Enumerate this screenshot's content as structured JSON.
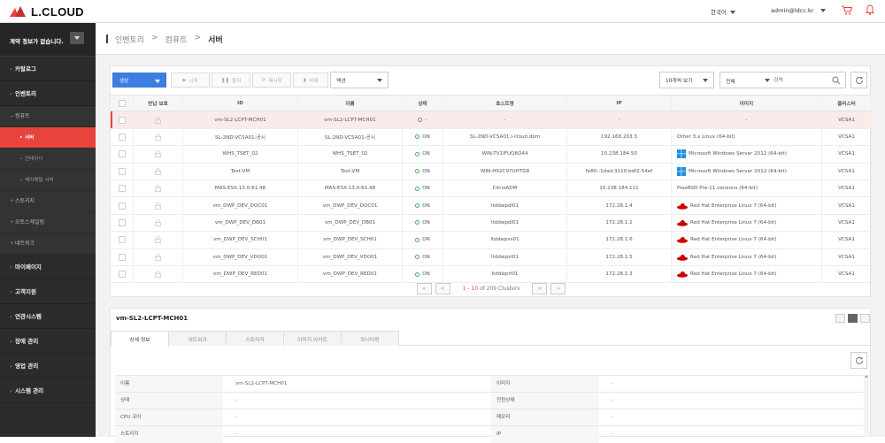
{
  "brand": {
    "name": "L.CLOUD",
    "colors": {
      "accent": "#e8433d",
      "primary": "#3d7ee0",
      "sidebar": "#2b2b2b"
    }
  },
  "topbar": {
    "language": "한국어",
    "user": "admin@ldcc.kr",
    "cart_icon": "cart-icon",
    "bell_icon": "bell-icon"
  },
  "sidebar": {
    "contract": "계약 정보가 없습니다.",
    "items": [
      {
        "label": "카탈로그",
        "level": 1
      },
      {
        "label": "인벤토리",
        "level": 1
      },
      {
        "label": "컴퓨트",
        "level": 2
      },
      {
        "label": "서버",
        "level": 3,
        "active": true
      },
      {
        "label": "컨테이너",
        "level": 3
      },
      {
        "label": "베어메탈 서버",
        "level": 3
      },
      {
        "label": "스토리지",
        "level": 2
      },
      {
        "label": "오토스케일링",
        "level": 2
      },
      {
        "label": "네트워크",
        "level": 2
      },
      {
        "label": "마이페이지",
        "level": 1
      },
      {
        "label": "고객지원",
        "level": 1
      },
      {
        "label": "연관시스템",
        "level": 1
      },
      {
        "label": "장애 관리",
        "level": 1
      },
      {
        "label": "영업 관리",
        "level": 1
      },
      {
        "label": "시스템 관리",
        "level": 1
      }
    ]
  },
  "breadcrumb": {
    "items": [
      "인벤토리",
      ">",
      "컴퓨트",
      ">",
      "서버"
    ]
  },
  "toolbar": {
    "create": "생성",
    "start": "시작",
    "stop": "중지",
    "restart": "재시작",
    "delete": "삭제",
    "action": "액션",
    "page_size": "10개씩 보기",
    "filter": "전체",
    "search_placeholder": "검색"
  },
  "table": {
    "headers": [
      "",
      "반납 보호",
      "ID",
      "이름",
      "상태",
      "호스트명",
      "IP",
      "이미지",
      "클러스터"
    ],
    "rows": [
      {
        "id": "vm-SL2-LCPT-MCH01",
        "name": "vm-SL2-LCPT-MCH01",
        "status": "-",
        "status_on": false,
        "host": "-",
        "ip": "-",
        "image": "-",
        "os": "none",
        "cluster": "VCSA1",
        "selected": true
      },
      {
        "id": "SL-2ND-VCSA01-공시",
        "name": "SL-2ND-VCSA01-공시",
        "status": "ON",
        "status_on": true,
        "host": "SL-2ND-VCSA01.l-cloud.dom",
        "ip": "192.168.203.3",
        "image": "Other 3.x Linux (64-bit)",
        "os": "none",
        "cluster": "VCSA1"
      },
      {
        "id": "WHS_TSET_02",
        "name": "WHS_TSET_02",
        "status": "ON",
        "status_on": true,
        "host": "WIN-TV1IFUQ6Q44",
        "ip": "10.238.184.50",
        "image": "Microsoft Windows Server 2012 (64-bit)",
        "os": "windows",
        "cluster": "VCSA1"
      },
      {
        "id": "Test-VM",
        "name": "Test-VM",
        "status": "ON",
        "status_on": true,
        "host": "WIN-H92C97UHTG8",
        "ip": "fe80::1dad:3110:bdf2:54ef",
        "image": "Microsoft Windows Server 2012 (64-bit)",
        "os": "windows",
        "cluster": "VCSA1"
      },
      {
        "id": "MAS-ESX-13.0-61.48",
        "name": "MAS-ESX-13.0-61.48",
        "status": "ON",
        "status_on": true,
        "host": "CitrixADM",
        "ip": "10.238.184.111",
        "image": "FreeBSD Pre-11 versions (64-bit)",
        "os": "none",
        "cluster": "VCSA1"
      },
      {
        "id": "vm_DWP_DEV_DOC01",
        "name": "vm_DWP_DEV_DOC01",
        "status": "ON",
        "status_on": true,
        "host": "ltddwpdl01",
        "ip": "172.28.1.4",
        "image": "Red Hat Enterprise Linux 7 (64-bit)",
        "os": "redhat",
        "cluster": "VCSA1"
      },
      {
        "id": "vm_DWP_DEV_DB01",
        "name": "vm_DWP_DEV_DB01",
        "status": "ON",
        "status_on": true,
        "host": "ltddwpdl01",
        "ip": "172.28.1.2",
        "image": "Red Hat Enterprise Linux 7 (64-bit)",
        "os": "redhat",
        "cluster": "VCSA1"
      },
      {
        "id": "vm_DWP_DEV_SCH01",
        "name": "vm_DWP_DEV_SCH01",
        "status": "ON",
        "status_on": true,
        "host": "ltddwpvs01",
        "ip": "172.28.1.6",
        "image": "Red Hat Enterprise Linux 7 (64-bit)",
        "os": "redhat",
        "cluster": "VCSA1"
      },
      {
        "id": "vm_DWP_DEV_VDO01",
        "name": "vm_DWP_DEV_VDO01",
        "status": "ON",
        "status_on": true,
        "host": "ltddwpvl01",
        "ip": "172.28.1.5",
        "image": "Red Hat Enterprise Linux 7 (64-bit)",
        "os": "redhat",
        "cluster": "VCSA1"
      },
      {
        "id": "vm_DWP_DEV_RED01",
        "name": "vm_DWP_DEV_RED01",
        "status": "ON",
        "status_on": true,
        "host": "ltddwprl01",
        "ip": "172.28.1.3",
        "image": "Red Hat Enterprise Linux 7 (64-bit)",
        "os": "redhat",
        "cluster": "VCSA1"
      }
    ]
  },
  "pager": {
    "first": "«",
    "prev": "<",
    "range": "1 - 10",
    "total": "of 209 Clusters",
    "next": ">",
    "last": "»"
  },
  "detail": {
    "title": "vm-SL2-LCPT-MCH01",
    "tabs": [
      "상세 정보",
      "네트워크",
      "스토리지",
      "이미지 아카트",
      "모니터링"
    ],
    "rows": [
      {
        "l1": "이름",
        "v1": "vm-SL2-LCPT-MCH01",
        "l2": "이미지",
        "v2": "-"
      },
      {
        "l1": "상태",
        "v1": "-",
        "l2": "전원상태",
        "v2": "-"
      },
      {
        "l1": "CPU 코어",
        "v1": "-",
        "l2": "메모리",
        "v2": "-"
      },
      {
        "l1": "스토리지",
        "v1": "-",
        "l2": "IP",
        "v2": "-"
      }
    ]
  }
}
